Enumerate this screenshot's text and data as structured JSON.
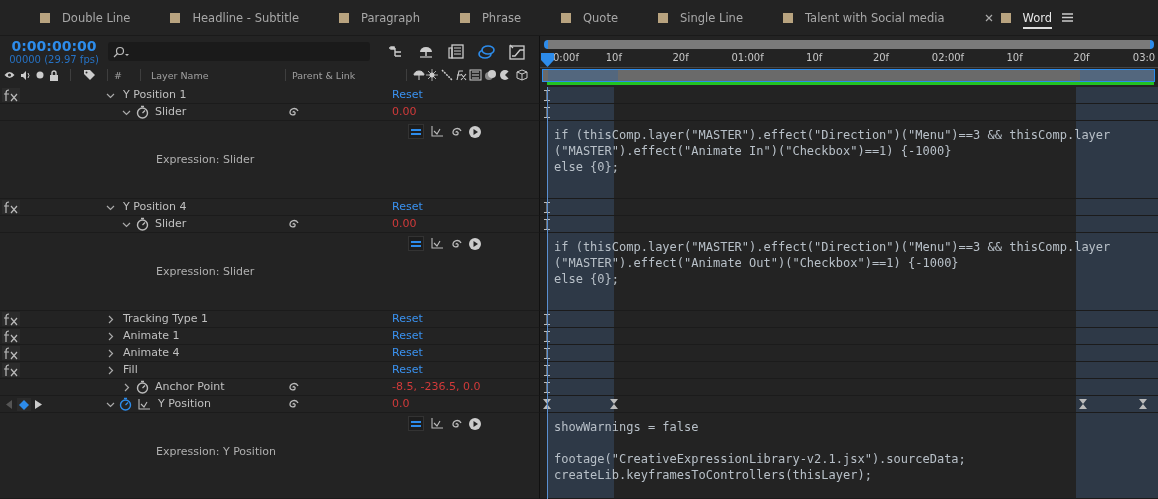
{
  "tabs": [
    {
      "label": "Double Line",
      "selected": false
    },
    {
      "label": "Headline - Subtitle",
      "selected": false
    },
    {
      "label": "Paragraph",
      "selected": false
    },
    {
      "label": "Phrase",
      "selected": false
    },
    {
      "label": "Quote",
      "selected": false
    },
    {
      "label": "Single Line",
      "selected": false
    },
    {
      "label": "Talent with Social media",
      "selected": false
    },
    {
      "label": "Word",
      "selected": true
    }
  ],
  "time": {
    "timecode": "0:00:00:00",
    "frames": "00000 (29.97 fps)"
  },
  "columns": {
    "number": "#",
    "layer_name": "Layer Name",
    "parent": "Parent & Link"
  },
  "ruler": [
    "0:00f",
    "10f",
    "20f",
    "01:00f",
    "10f",
    "20f",
    "02:00f",
    "10f",
    "20f",
    "03:0"
  ],
  "rows": [
    {
      "kind": "effect",
      "name": "Y Position 1",
      "value": "Reset",
      "expanded": true
    },
    {
      "kind": "property",
      "name": "Slider",
      "value": "0.00",
      "expanded": true,
      "keyframed": false
    },
    {
      "kind": "expression",
      "label": "Expression: Slider",
      "code": "if (thisComp.layer(\"MASTER\").effect(\"Direction\")(\"Menu\")==3 && thisComp.layer\n(\"MASTER\").effect(\"Animate In\")(\"Checkbox\")==1) {-1000}\nelse {0};"
    },
    {
      "kind": "effect",
      "name": "Y Position 4",
      "value": "Reset",
      "expanded": true
    },
    {
      "kind": "property",
      "name": "Slider",
      "value": "0.00",
      "expanded": true,
      "keyframed": false
    },
    {
      "kind": "expression",
      "label": "Expression: Slider",
      "code": "if (thisComp.layer(\"MASTER\").effect(\"Direction\")(\"Menu\")==3 && thisComp.layer\n(\"MASTER\").effect(\"Animate Out\")(\"Checkbox\")==1) {-1000}\nelse {0};"
    },
    {
      "kind": "effect",
      "name": "Tracking Type 1",
      "value": "Reset",
      "expanded": false
    },
    {
      "kind": "effect",
      "name": "Animate 1",
      "value": "Reset",
      "expanded": false
    },
    {
      "kind": "effect",
      "name": "Animate 4",
      "value": "Reset",
      "expanded": false
    },
    {
      "kind": "effect",
      "name": "Fill",
      "value": "Reset",
      "expanded": false
    },
    {
      "kind": "property",
      "name": "Anchor Point",
      "value": "-8.5, -236.5, 0.0",
      "expanded": false,
      "keyframed": false
    },
    {
      "kind": "property",
      "name": "Y Position",
      "value": "0.0",
      "expanded": true,
      "keyframed": true
    },
    {
      "kind": "expression",
      "label": "Expression: Y Position",
      "code": "showWarnings = false\n\nfootage(\"CreativeExpressionLibrary-v2.1.jsx\").sourceData;\ncreateLib.keyframesToControllers(thisLayer);"
    }
  ]
}
